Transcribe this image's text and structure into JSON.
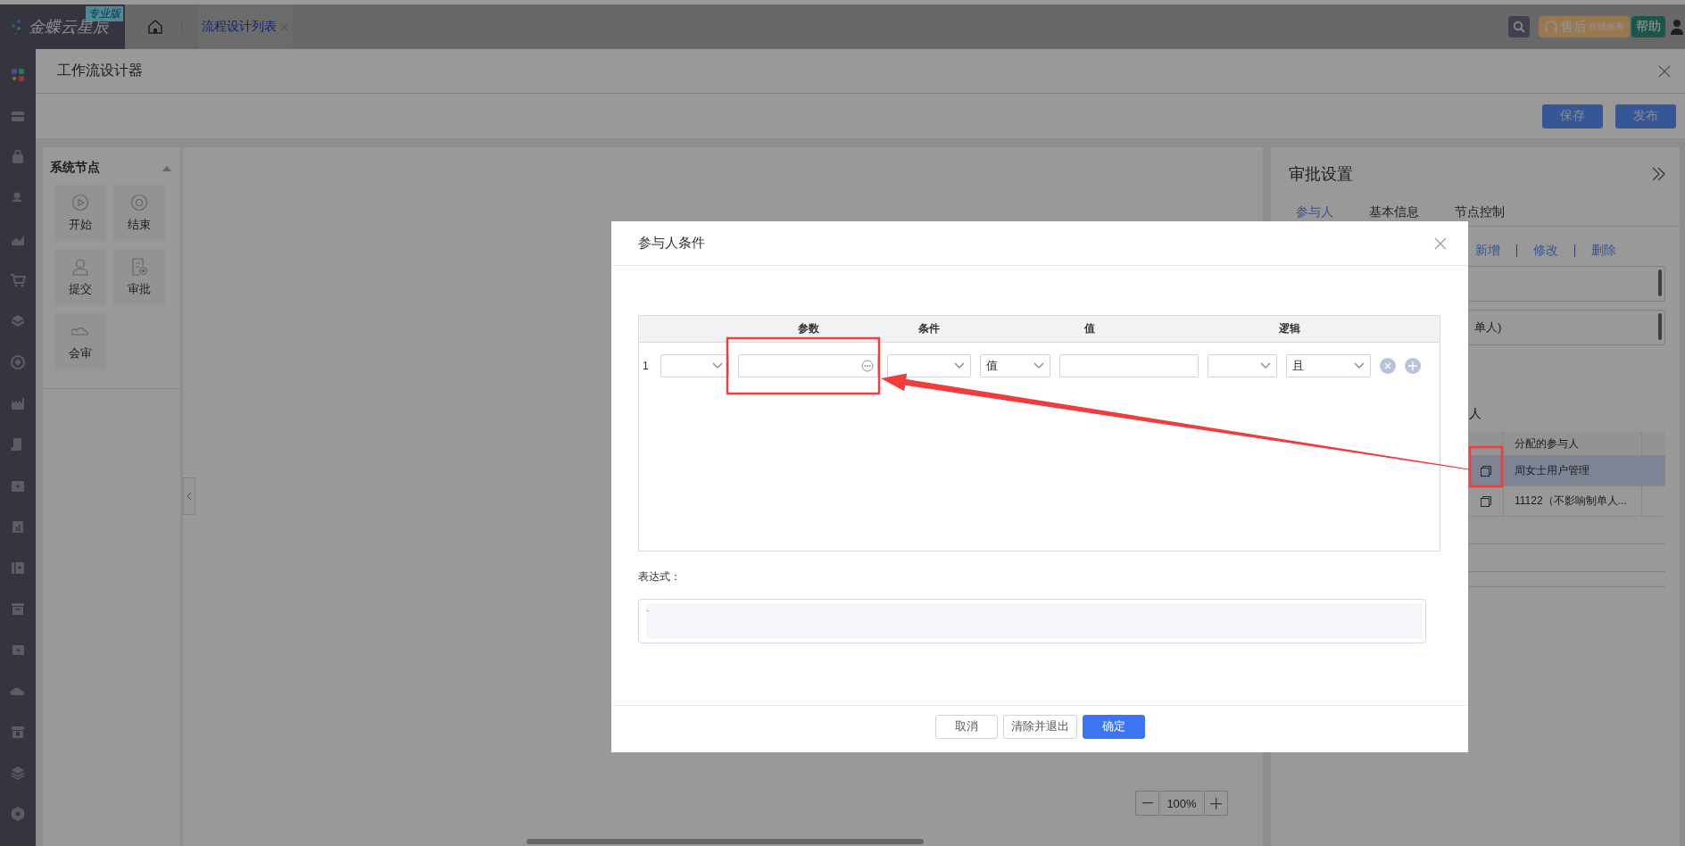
{
  "top_bar": {
    "logo": "金蝶云星辰",
    "edition_badge": "专业版",
    "tabs": [
      {
        "label": "流程设计列表",
        "selected": true
      }
    ],
    "service_button": {
      "main": "售后",
      "sub": "在线服务"
    },
    "help_button": "帮助"
  },
  "designer": {
    "title": "工作流设计器",
    "toolbar_buttons": [
      {
        "label": "保存"
      },
      {
        "label": "发布"
      }
    ]
  },
  "node_panel": {
    "title": "系统节点",
    "expanded": true,
    "nodes": [
      {
        "label": "开始",
        "kind": "start"
      },
      {
        "label": "结束",
        "kind": "end"
      },
      {
        "label": "提交",
        "kind": "submit"
      },
      {
        "label": "审批",
        "kind": "approve"
      },
      {
        "label": "会审",
        "kind": "countersign"
      }
    ]
  },
  "canvas": {
    "zoom": "100%"
  },
  "approval_panel": {
    "title": "审批设置",
    "tabs": [
      {
        "label": "参与人",
        "selected": true
      },
      {
        "label": "基本信息",
        "selected": false
      },
      {
        "label": "节点控制",
        "selected": false
      }
    ],
    "actions": [
      "新增",
      "修改",
      "删除"
    ],
    "fields": [
      {
        "kind": "blank"
      },
      {
        "kind": "text",
        "value": "单人)"
      }
    ],
    "section_label": "人",
    "table": {
      "columns": [
        "分配的参与人"
      ],
      "rows": [
        {
          "participant": "周女士用户管理",
          "selected": true
        },
        {
          "participant": "11122（不影响制单人...",
          "selected": false
        }
      ]
    }
  },
  "dialog": {
    "title": "参与人条件",
    "columns": [
      {
        "label": "参数",
        "kind": "param"
      },
      {
        "label": "条件",
        "kind": "condition"
      },
      {
        "label": "值",
        "kind": "value"
      },
      {
        "label": "逻辑",
        "kind": "logic"
      }
    ],
    "rows": [
      {
        "index": "1",
        "value_type": "值",
        "logic": "且"
      }
    ],
    "expression_label": "表达式：",
    "expression_value": "-",
    "buttons": [
      {
        "label": "取消",
        "kind": "default"
      },
      {
        "label": "清除并退出",
        "kind": "default"
      },
      {
        "label": "确定",
        "kind": "primary"
      }
    ]
  }
}
